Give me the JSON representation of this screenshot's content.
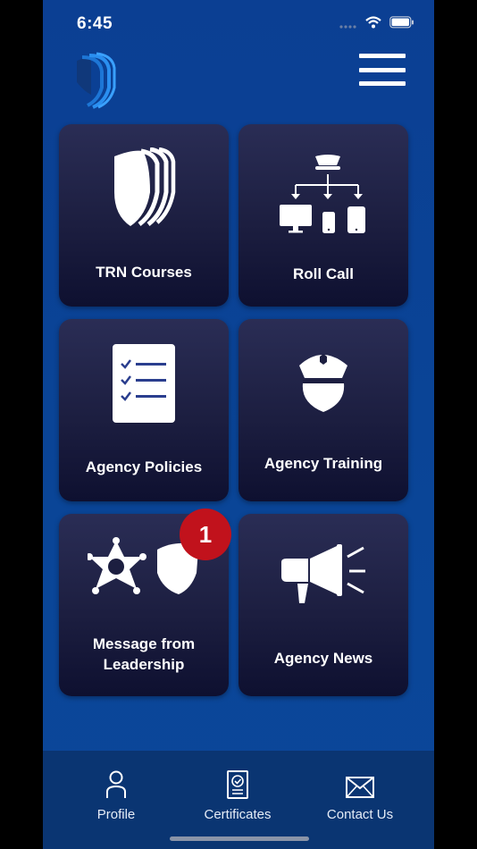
{
  "status_bar": {
    "time": "6:45"
  },
  "tiles": [
    {
      "label": "TRN Courses"
    },
    {
      "label": "Roll Call"
    },
    {
      "label": "Agency Policies"
    },
    {
      "label": "Agency Training"
    },
    {
      "label_line1": "Message from",
      "label_line2": "Leadership",
      "badge": "1"
    },
    {
      "label": "Agency News"
    }
  ],
  "tab_bar": {
    "profile": "Profile",
    "certificates": "Certificates",
    "contact": "Contact Us"
  },
  "colors": {
    "background": "#0b4296",
    "tile": "#1c1e40",
    "badge": "#c1121c",
    "tab_bar": "#0a3572"
  },
  "icons": [
    "shield-logo-icon",
    "hamburger-menu-icon",
    "shield-icon",
    "org-chart-devices-icon",
    "checklist-icon",
    "police-officer-icon",
    "sheriff-star-badge-icon",
    "megaphone-icon",
    "person-icon",
    "certificate-icon",
    "envelope-icon"
  ]
}
